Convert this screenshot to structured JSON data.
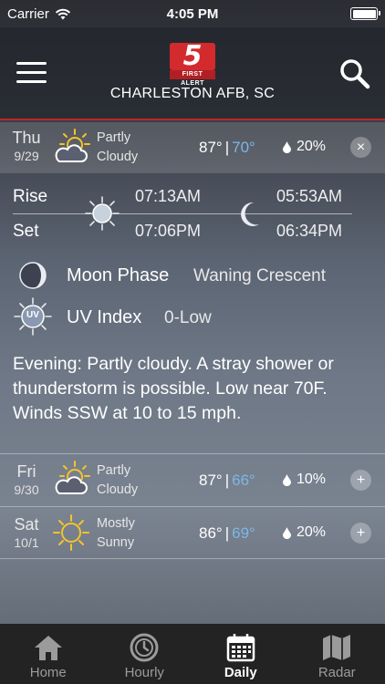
{
  "status_bar": {
    "carrier": "Carrier",
    "time": "4:05 PM"
  },
  "header": {
    "location": "CHARLESTON AFB, SC",
    "logo_number": "5",
    "logo_text": "FIRST ALERT"
  },
  "days": [
    {
      "day": "Thu",
      "date": "9/29",
      "condition_line1": "Partly",
      "condition_line2": "Cloudy",
      "high": "87°",
      "separator": "|",
      "low": "70°",
      "precip": "20%",
      "icon": "partly-cloudy-icon",
      "button": "×"
    },
    {
      "day": "Fri",
      "date": "9/30",
      "condition_line1": "Partly",
      "condition_line2": "Cloudy",
      "high": "87°",
      "separator": "|",
      "low": "66°",
      "precip": "10%",
      "icon": "partly-cloudy-icon",
      "button": "+"
    },
    {
      "day": "Sat",
      "date": "10/1",
      "condition_line1": "Mostly",
      "condition_line2": "Sunny",
      "high": "86°",
      "separator": "|",
      "low": "69°",
      "precip": "20%",
      "icon": "sunny-icon",
      "button": "+"
    }
  ],
  "detail": {
    "rise_label": "Rise",
    "set_label": "Set",
    "sunrise": "07:13AM",
    "sunset": "07:06PM",
    "moonrise": "05:53AM",
    "moonset": "06:34PM",
    "moon_phase_label": "Moon Phase",
    "moon_phase_value": "Waning Crescent",
    "uv_label": "UV Index",
    "uv_value": "0-Low",
    "uv_icon_text": "UV",
    "forecast": "Evening: Partly cloudy. A stray shower or thunderstorm is possible. Low near 70F. Winds SSW at 10 to 15 mph."
  },
  "tabs": [
    {
      "label": "Home",
      "icon": "home-icon",
      "active": false
    },
    {
      "label": "Hourly",
      "icon": "clock-icon",
      "active": false
    },
    {
      "label": "Daily",
      "icon": "calendar-icon",
      "active": true
    },
    {
      "label": "Radar",
      "icon": "map-icon",
      "active": false
    }
  ],
  "colors": {
    "accent_red": "#c0262d",
    "low_temp_blue": "#7cb7e8",
    "tab_bar": "#232323",
    "sun_yellow": "#f5c32c"
  }
}
